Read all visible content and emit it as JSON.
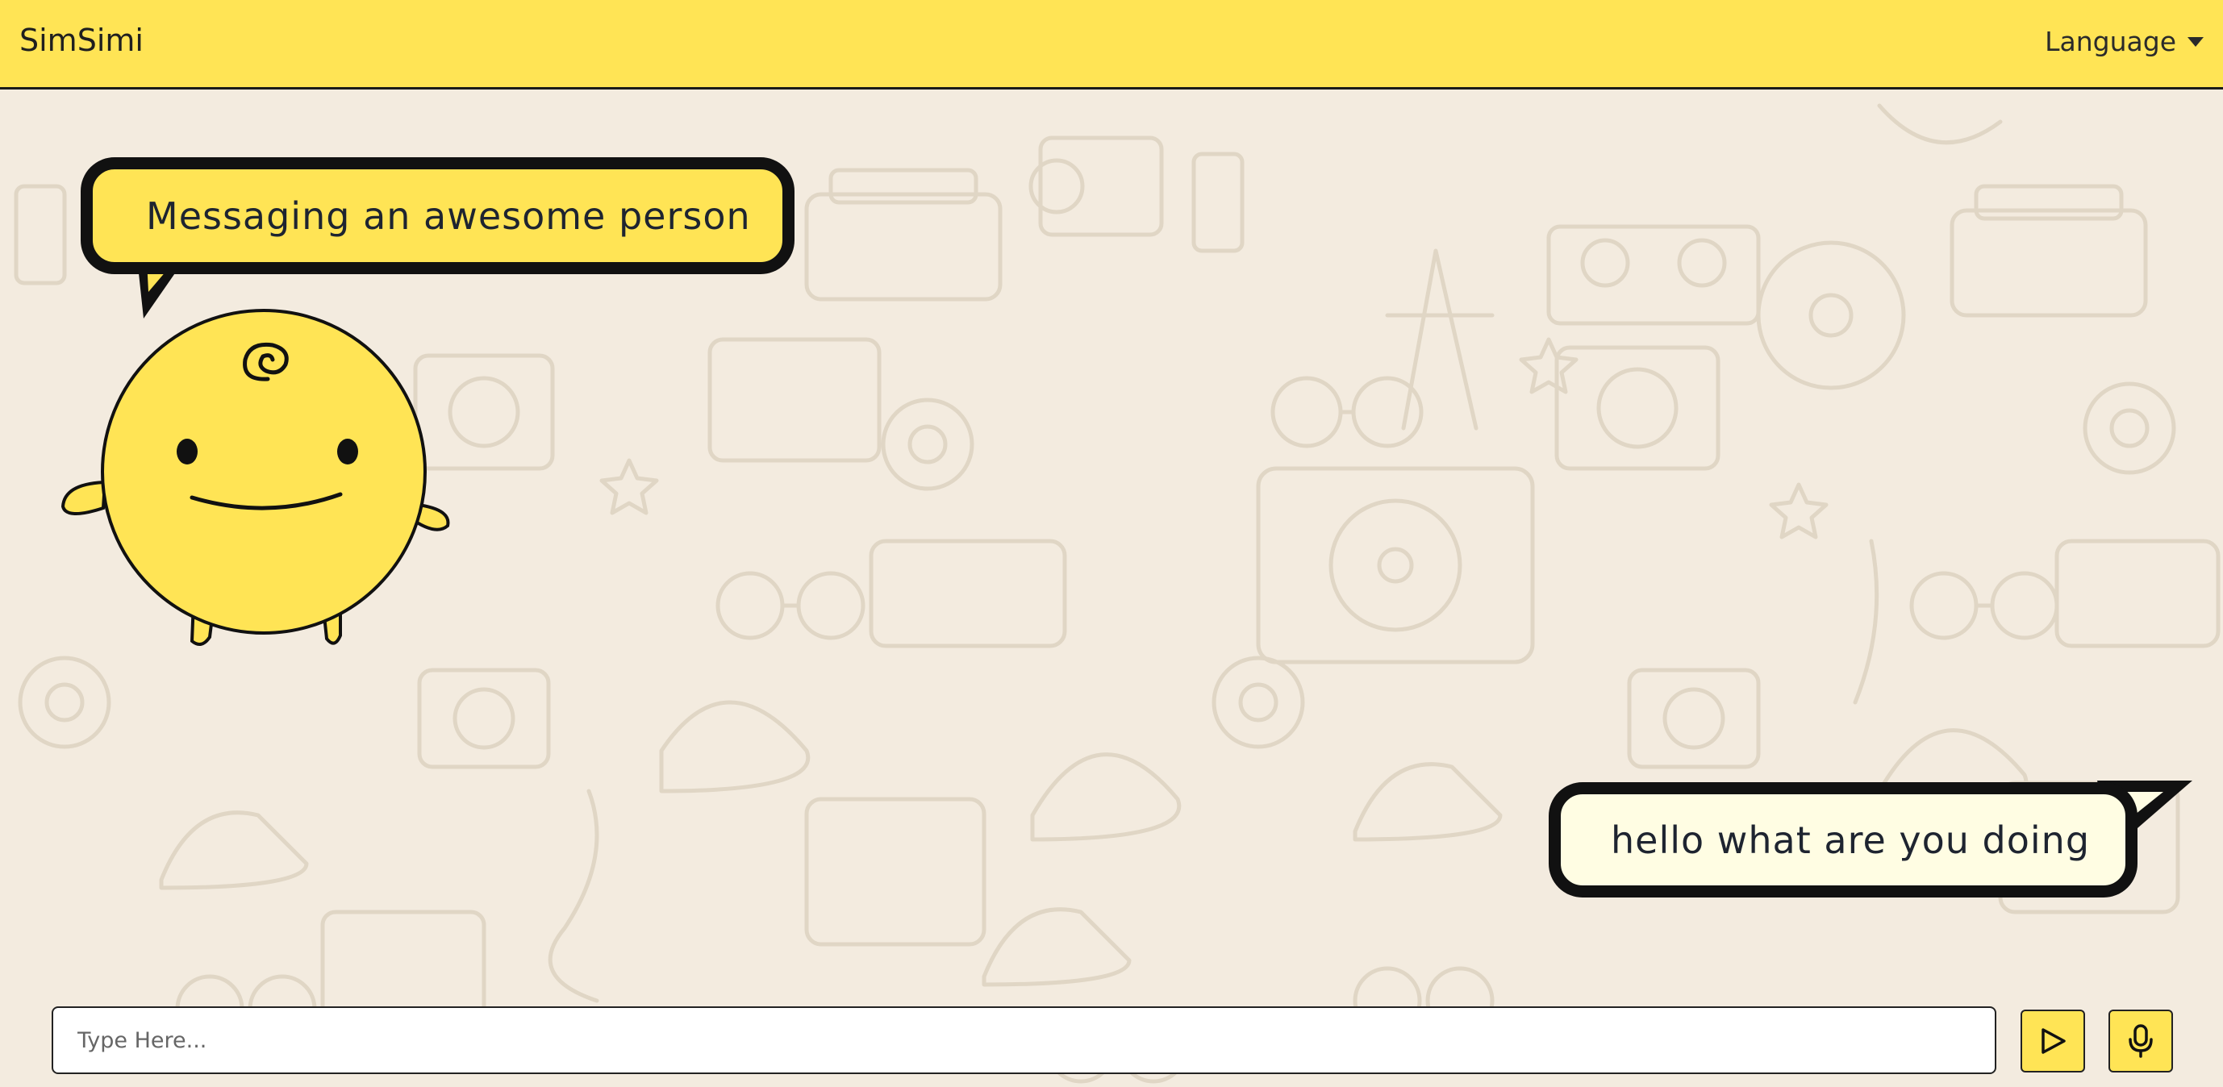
{
  "navbar": {
    "brand": "SimSimi",
    "language_label": "Language"
  },
  "chat": {
    "messages": [
      {
        "sender": "simsimi",
        "text": "Messaging an awesome person"
      },
      {
        "sender": "user",
        "text": "hello what are you doing"
      }
    ]
  },
  "composer": {
    "placeholder": "Type Here...",
    "value": "",
    "send_icon": "send-icon",
    "mic_icon": "microphone-icon"
  },
  "colors": {
    "accent": "#ffe455",
    "background": "#f3ebdf",
    "user_bubble": "#fffde3",
    "outline": "#111111"
  }
}
